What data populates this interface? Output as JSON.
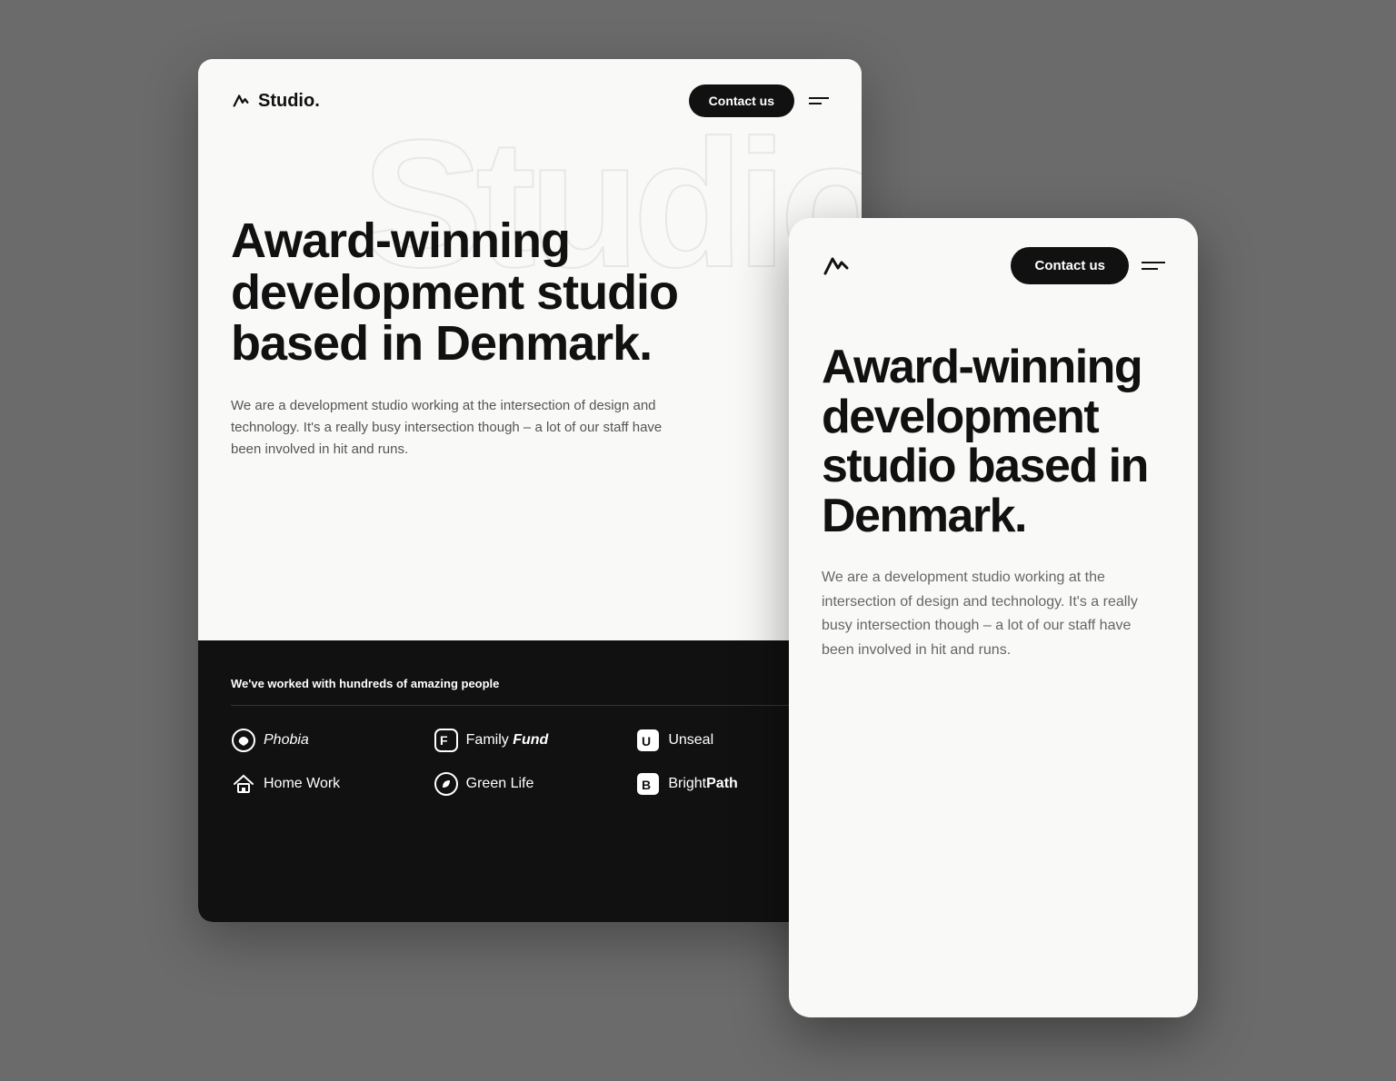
{
  "desktop": {
    "logo_text": "Studio.",
    "nav": {
      "contact_label": "Contact us"
    },
    "bg_decorative": "Studio.",
    "hero": {
      "heading": "Award-winning development studio based in Denmark.",
      "subtext": "We are a development studio working at the intersection of design and technology. It's a really busy intersection though – a lot of our staff have been involved in hit and runs."
    },
    "dark_section": {
      "label": "We've worked with hundreds of amazing people",
      "clients": [
        {
          "name": "Phobia",
          "style": "phobia"
        },
        {
          "name": "Family Fund",
          "style": "family-fund"
        },
        {
          "name": "Unseal",
          "style": "unseal"
        },
        {
          "name": "Home Work",
          "style": "homework"
        },
        {
          "name": "Green Life",
          "style": "greenlife"
        },
        {
          "name": "BrightPath",
          "style": "brightpath"
        }
      ]
    }
  },
  "mobile": {
    "nav": {
      "contact_label": "Contact us"
    },
    "hero": {
      "heading": "Award-winning development studio based in Denmark.",
      "subtext": "We are a development studio working at the intersection of design and technology. It's a really busy intersection though – a lot of our staff have been involved in hit and runs."
    }
  }
}
